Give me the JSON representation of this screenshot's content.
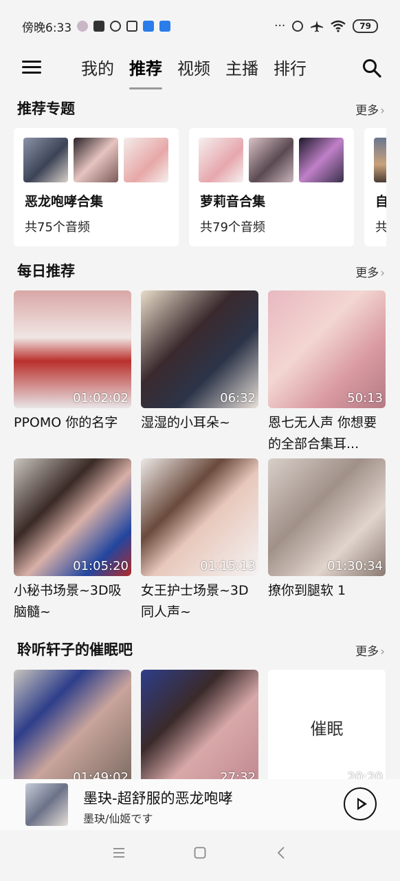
{
  "status_bar": {
    "time": "傍晚6:33",
    "battery": "79",
    "dots": "···"
  },
  "nav": {
    "tabs": [
      {
        "label": "我的",
        "active": false
      },
      {
        "label": "推荐",
        "active": true
      },
      {
        "label": "视频",
        "active": false
      },
      {
        "label": "主播",
        "active": false
      },
      {
        "label": "排行",
        "active": false
      }
    ],
    "menu_icon": "hamburger-menu-icon",
    "search_icon": "search-icon"
  },
  "recommended_topics": {
    "title": "推荐专题",
    "more": "更多",
    "cards": [
      {
        "name": "恶龙咆哮合集",
        "count": "共75个音频"
      },
      {
        "name": "萝莉音合集",
        "count": "共79个音频"
      },
      {
        "name": "自",
        "count": "共"
      }
    ]
  },
  "daily": {
    "title": "每日推荐",
    "more": "更多",
    "items": [
      {
        "title": "PPOMO 你的名字",
        "duration": "01:02:02"
      },
      {
        "title": "湿湿的小耳朵~",
        "duration": "06:32"
      },
      {
        "title": "恩七无人声 你想要的全部合集耳...",
        "duration": "50:13"
      },
      {
        "title": "小秘书场景~3D吸脑髓~",
        "duration": "01:05:20"
      },
      {
        "title": "女王护士场景~3D同人声~",
        "duration": "01:15:13"
      },
      {
        "title": "撩你到腿软 1",
        "duration": "01:30:34"
      }
    ]
  },
  "hypnosis": {
    "title": "聆听轩子的催眠吧",
    "more": "更多",
    "items": [
      {
        "duration": "01:49:02",
        "cover_text": ""
      },
      {
        "duration": "27:32",
        "cover_text": ""
      },
      {
        "duration": "20:20",
        "cover_text": "催眠"
      }
    ]
  },
  "player": {
    "title": "墨玦-超舒服的恶龙咆哮",
    "artist": "墨玦/仙姬です"
  },
  "system_nav": {
    "menu": "≡",
    "home": "▢",
    "back": "‹"
  },
  "colors": {
    "background": "#f4f4f4",
    "card": "#ffffff",
    "accent_blue": "#2b7de9"
  }
}
